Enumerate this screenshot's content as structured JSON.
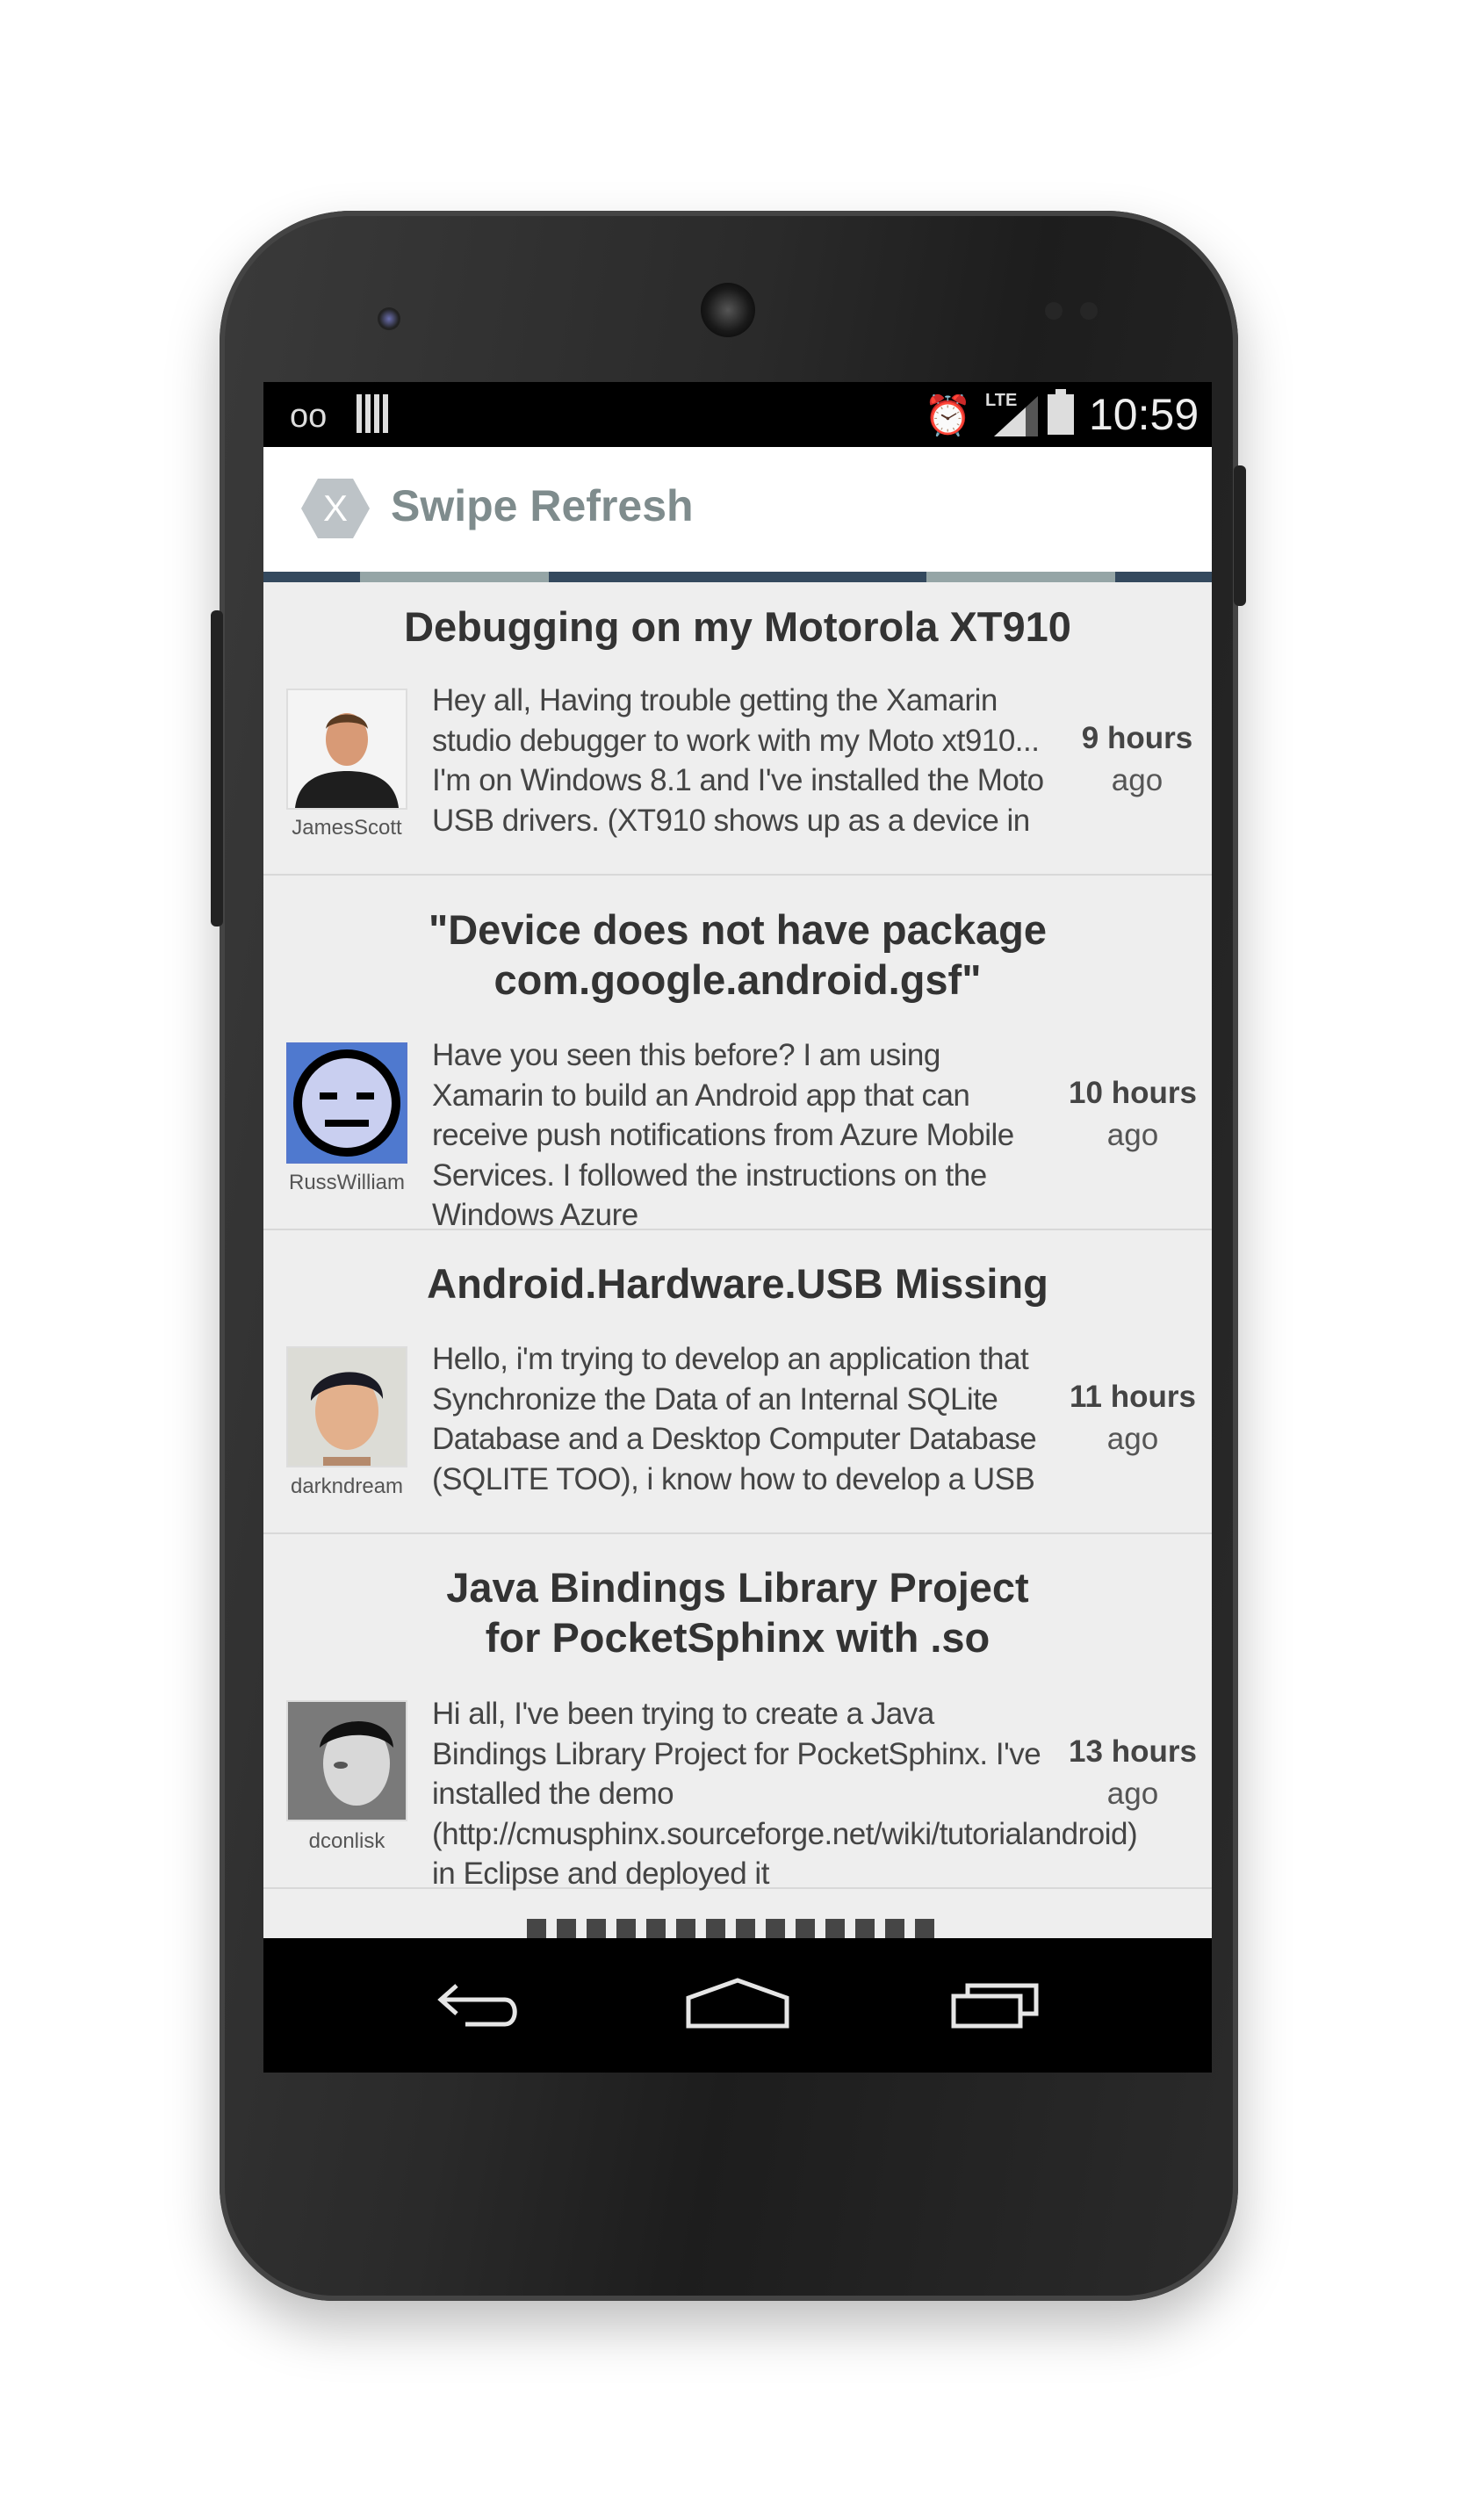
{
  "status_bar": {
    "voicemail_icon": "voicemail-icon",
    "sd_icon": "sd-card-icon",
    "alarm_icon": "alarm-icon",
    "network_label": "LTE",
    "battery_icon": "battery-charging-icon",
    "time": "10:59"
  },
  "action_bar": {
    "logo_icon": "xamarin-logo-icon",
    "logo_letter": "X",
    "title": "Swipe Refresh"
  },
  "colors": {
    "action_title": "#7f8c8d",
    "progress_bar": "#34495e",
    "progress_segment": "#95a5a6",
    "list_background": "#eeeeee"
  },
  "posts": [
    {
      "title": "Debugging on my Motorola XT910",
      "author": "JamesScott",
      "excerpt": "Hey all,  Having trouble getting the Xamarin studio debugger to work with my Moto xt910... I'm on Windows 8.1 and I've installed the Moto USB drivers.  (XT910 shows up as a device in",
      "time_value": "9 hours",
      "time_suffix": "ago"
    },
    {
      "title": "\"Device does not have package com.google.android.gsf\"",
      "author": "RussWilliam",
      "excerpt": "Have you seen this before? I am using Xamarin to build an Android app that can receive push notifications from Azure Mobile Services.  I followed the instructions on the Windows Azure",
      "time_value": "10 hours",
      "time_suffix": "ago"
    },
    {
      "title": "Android.Hardware.USB Missing",
      "author": "darkndream",
      "excerpt": "Hello, i'm trying to develop an application that Synchronize the Data of an Internal SQLite Database and a Desktop Computer Database (SQLITE TOO), i know how to develop a USB",
      "time_value": "11 hours",
      "time_suffix": "ago"
    },
    {
      "title": "Java Bindings Library Project for PocketSphinx with .so",
      "author": "dconlisk",
      "excerpt": "Hi all,  I've been trying to create a Java Bindings Library Project for PocketSphinx. I've installed the demo (http://cmusphinx.sourceforge.net/wiki/tutorialandroid) in Eclipse and deployed it",
      "time_value": "13 hours",
      "time_suffix": "ago"
    }
  ],
  "nav_bar": {
    "back_icon": "back-icon",
    "home_icon": "home-icon",
    "recents_icon": "recent-apps-icon"
  }
}
